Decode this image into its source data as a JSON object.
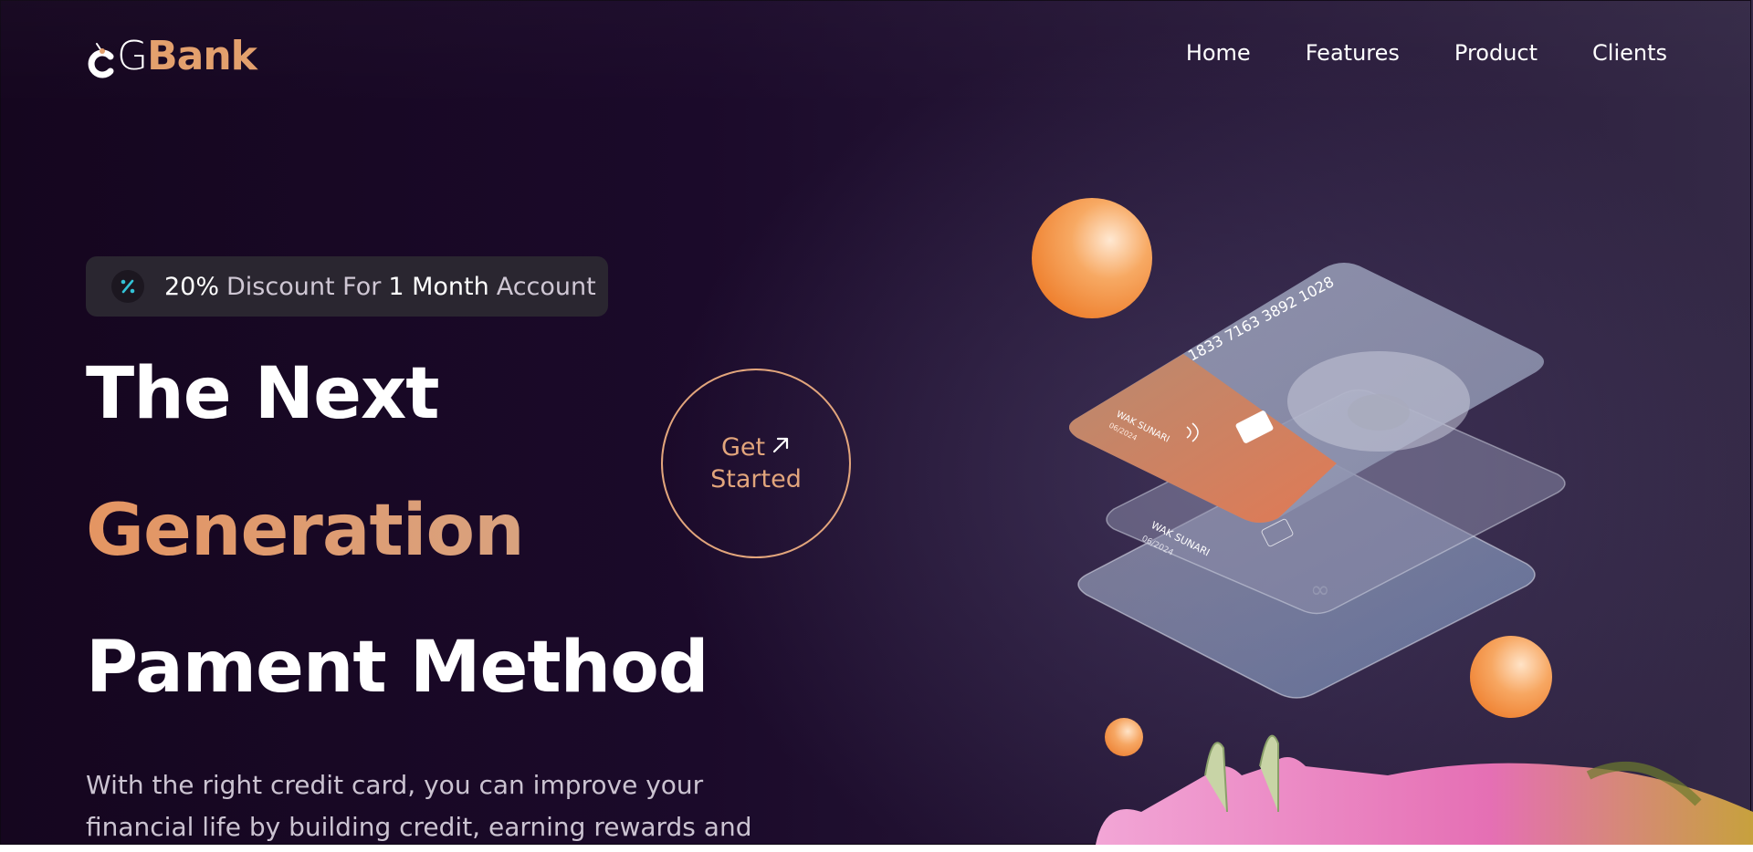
{
  "brand": {
    "logo_g": "G",
    "logo_bank": "Bank"
  },
  "nav": {
    "items": [
      "Home",
      "Features",
      "Product",
      "Clients"
    ]
  },
  "badge": {
    "percent": "20%",
    "text1": "Discount For",
    "duration": "1 Month",
    "text2": "Account",
    "icon": "percent-icon"
  },
  "hero": {
    "line1": "The Next",
    "line2": "Generation",
    "line3": "Pament Method",
    "description": "With the right credit card, you can improve your financial life by building credit, earning rewards and"
  },
  "cta": {
    "line1": "Get",
    "line2": "Started",
    "icon": "arrow-up-right-icon"
  },
  "cards": {
    "top_number": "1833 7163 3892 1028",
    "holder_1": "WAK SUNARI",
    "expiry_1": "06/2024",
    "holder_2": "WAK SUNARI",
    "expiry_2": "06/2024"
  },
  "colors": {
    "accent": "#e3a06d",
    "background": "#1b0a2a",
    "orange_ball": "#f08a3a"
  }
}
